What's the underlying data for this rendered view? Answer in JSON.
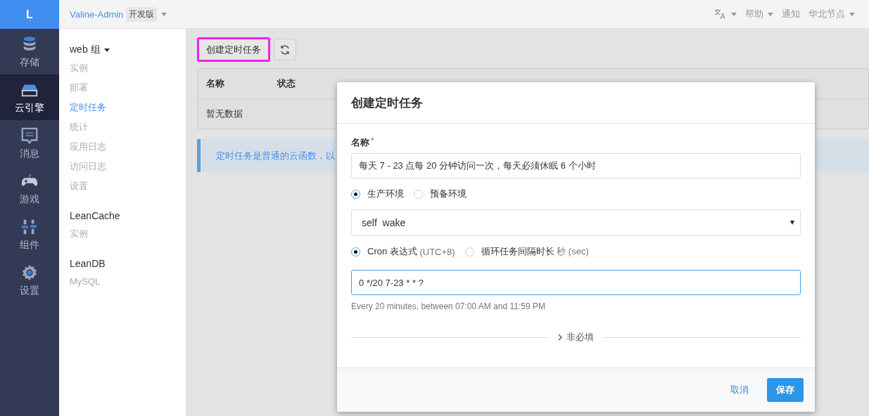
{
  "logo": "L",
  "rail": [
    {
      "label": "存储",
      "selected": false
    },
    {
      "label": "云引擎",
      "selected": true
    },
    {
      "label": "消息",
      "selected": false
    },
    {
      "label": "游戏",
      "selected": false
    },
    {
      "label": "组件",
      "selected": false
    },
    {
      "label": "设置",
      "selected": false
    }
  ],
  "topbar": {
    "app": "Valine-Admin",
    "badge": "开发版",
    "help": "帮助",
    "notify": "通知",
    "region": "华北节点"
  },
  "nav": [
    {
      "title": "web 组",
      "dropdown": true,
      "items": [
        {
          "label": "实例",
          "selected": false
        },
        {
          "label": "部署",
          "selected": false
        },
        {
          "label": "定时任务",
          "selected": true
        },
        {
          "label": "统计",
          "selected": false
        },
        {
          "label": "应用日志",
          "selected": false
        },
        {
          "label": "访问日志",
          "selected": false
        },
        {
          "label": "设置",
          "selected": false
        }
      ]
    },
    {
      "title": "LeanCache",
      "dropdown": false,
      "items": [
        {
          "label": "实例",
          "selected": false
        }
      ]
    },
    {
      "title": "LeanDB",
      "dropdown": false,
      "items": [
        {
          "label": "MySQL",
          "selected": false
        }
      ]
    }
  ],
  "toolbar": {
    "create": "创建定时任务",
    "highlighted": true
  },
  "table": {
    "columns": [
      "名称",
      "状态"
    ],
    "empty": "暂无数据"
  },
  "banner": "定时任务是普通的云函数，以",
  "modal": {
    "title": "创建定时任务",
    "name_label": "名称",
    "required_mark": "*",
    "name_value": "每天 7 - 23 点每 20 分钟访问一次，每天必须休眠 6 个小时",
    "env": [
      {
        "label": "生产环境",
        "selected": true
      },
      {
        "label": "预备环境",
        "selected": false
      }
    ],
    "function": "self  wake",
    "schedule": [
      {
        "label": "Cron 表达式",
        "note": "(UTC+8)",
        "selected": true
      },
      {
        "label": "循环任务间隔时长",
        "note": "秒 (sec)",
        "selected": false
      }
    ],
    "cron": "0 */20 7-23 * * ?",
    "cron_help": "Every 20 minutes, between 07:00 AM and 11:59 PM",
    "optional": "非必填",
    "cancel": "取消",
    "save": "保存"
  }
}
